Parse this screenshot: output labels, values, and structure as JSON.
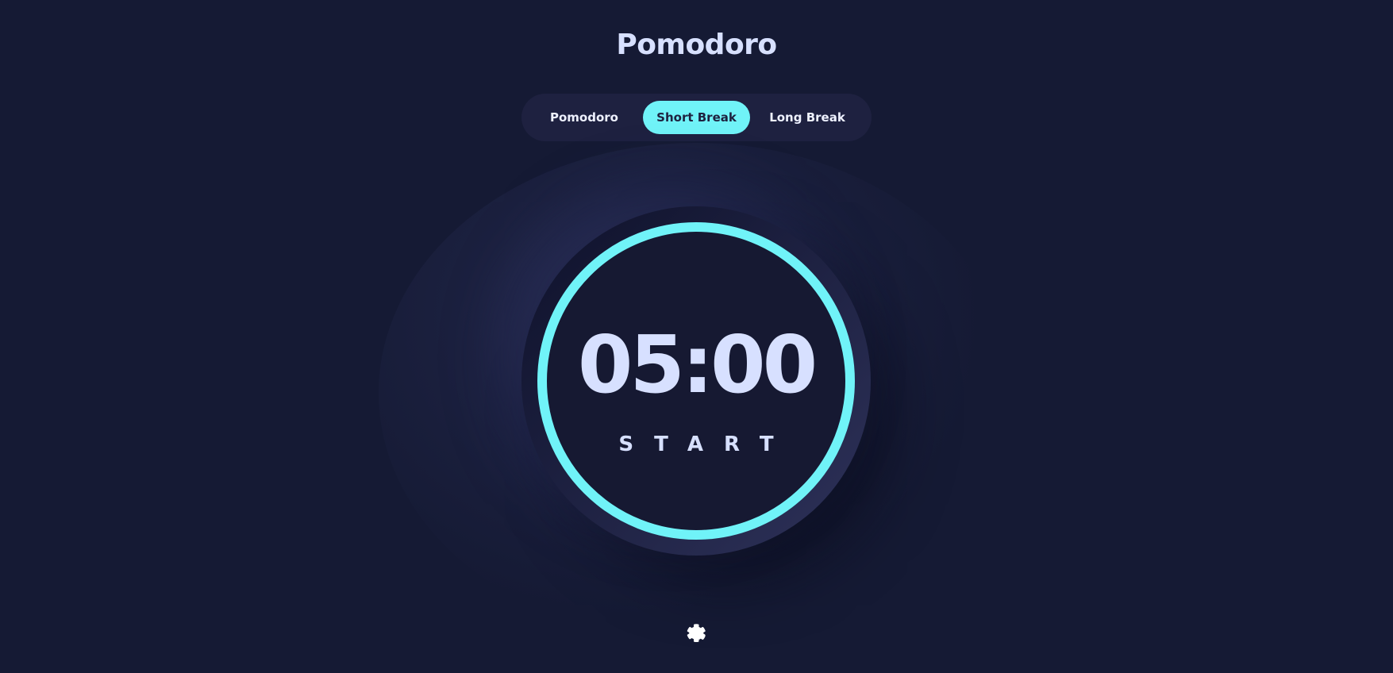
{
  "app": {
    "title": "Pomodoro"
  },
  "modes": {
    "items": [
      {
        "label": "Pomodoro",
        "active": false
      },
      {
        "label": "Short Break",
        "active": true
      },
      {
        "label": "Long Break",
        "active": false
      }
    ]
  },
  "timer": {
    "time": "05:00",
    "action_label": "START",
    "progress": 1.0
  },
  "icons": {
    "settings": "gear-icon"
  },
  "colors": {
    "background": "#151a34",
    "accent": "#70f3f8",
    "text": "#d7e0ff",
    "panel": "#1e2140"
  }
}
